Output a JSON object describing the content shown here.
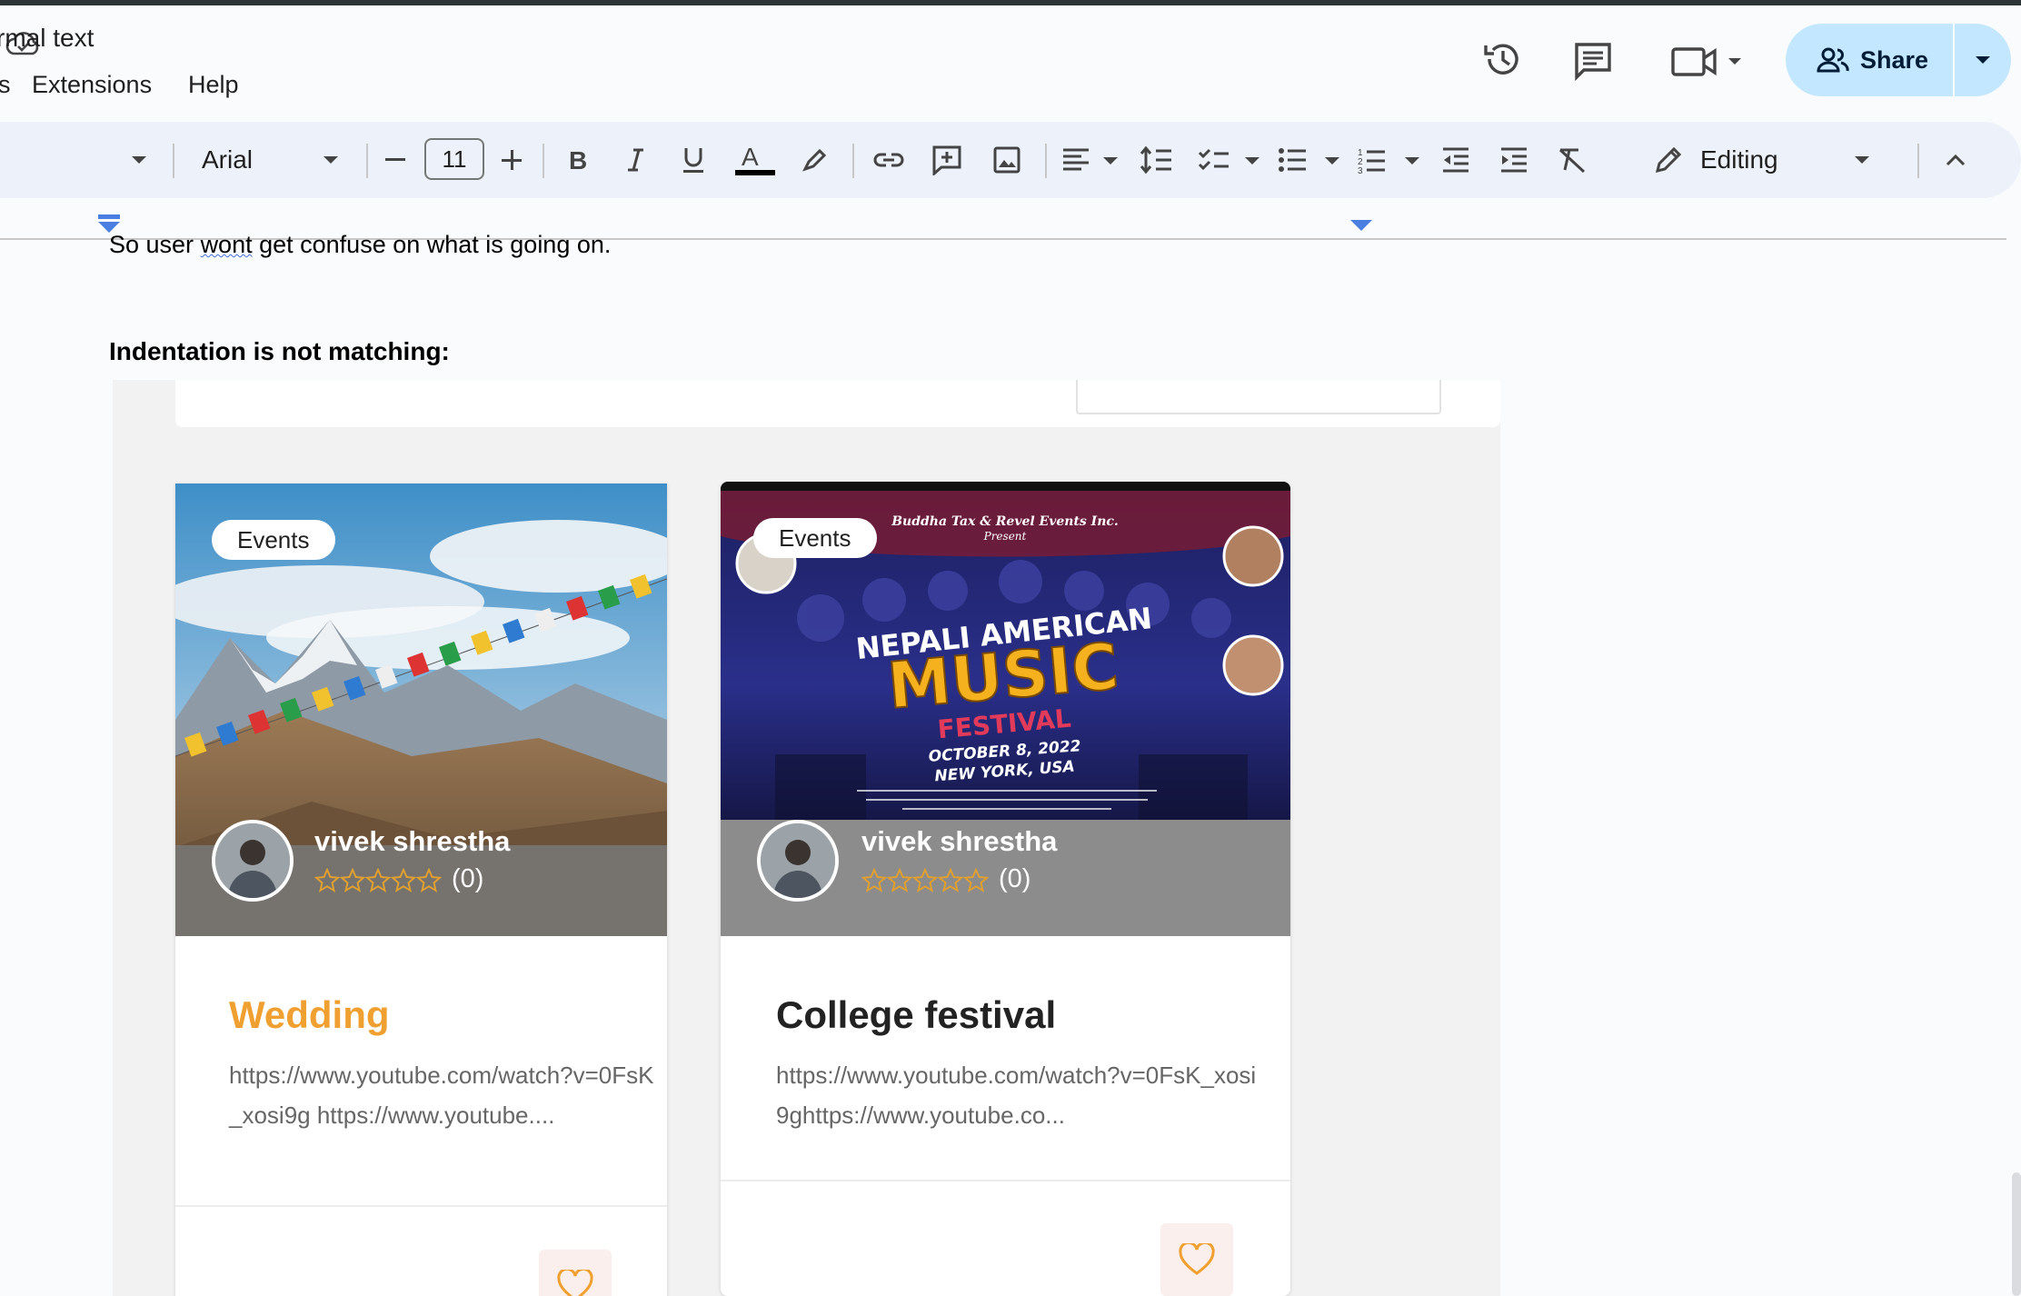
{
  "menu": {
    "cut_left": "s",
    "extensions": "Extensions",
    "help": "Help"
  },
  "header": {
    "share_label": "Share"
  },
  "toolbar": {
    "style_label": "rmal text",
    "font_label": "Arial",
    "font_size": "11",
    "mode_label": "Editing"
  },
  "document": {
    "line1_before": "So user ",
    "line1_misspelled": "wont",
    "line1_after": " get confuse on what is going on.",
    "heading": "Indentation is not matching:"
  },
  "cards": [
    {
      "badge": "Events",
      "author": "vivek shrestha",
      "rating_count": "(0)",
      "title": "Wedding",
      "title_color": "#f0a030",
      "description": "https://www.youtube.com/watch?v=0FsK_xosi9g https://www.youtube...."
    },
    {
      "badge": "Events",
      "author": "vivek shrestha",
      "rating_count": "(0)",
      "title": "College festival",
      "title_color": "#222222",
      "description": "https://www.youtube.com/watch?v=0FsK_xosi9ghttps://www.youtube.co..."
    }
  ],
  "poster": {
    "presenter": "Buddha Tax & Revel Events Inc.",
    "present": "Present",
    "line1": "NEPALI AMERICAN",
    "line2": "MUSIC",
    "line3": "FESTIVAL",
    "date": "OCTOBER 8, 2022",
    "place": "NEW YORK, USA"
  },
  "colors": {
    "share_bg": "#c2e7ff",
    "toolbar_bg": "#edf2fa",
    "accent_orange": "#f0a030"
  }
}
